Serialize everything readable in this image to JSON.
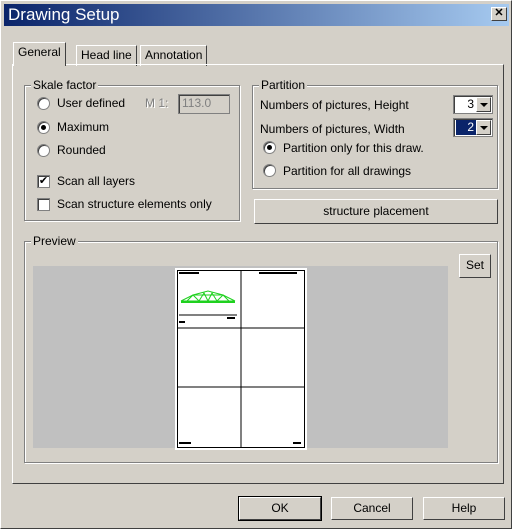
{
  "window": {
    "title": "Drawing Setup",
    "close_label": "✕"
  },
  "tabs": [
    {
      "label": "General"
    },
    {
      "label": "Head line"
    },
    {
      "label": "Annotation"
    }
  ],
  "skale": {
    "title": "Skale factor",
    "user_defined": "User defined",
    "m_label": "M 1:",
    "m_value": "113.0",
    "maximum": "Maximum",
    "rounded": "Rounded",
    "scan_all": "Scan all layers",
    "scan_structure": "Scan structure elements only"
  },
  "partition": {
    "title": "Partition",
    "height_label": "Numbers of pictures, Height",
    "height_value": "3",
    "width_label": "Numbers of pictures, Width",
    "width_value": "2",
    "only_this": "Partition only for this draw.",
    "all_drawings": "Partition for all drawings",
    "structure_btn": "structure placement"
  },
  "preview": {
    "title": "Preview",
    "set_btn": "Set"
  },
  "footer": {
    "ok": "OK",
    "cancel": "Cancel",
    "help": "Help"
  },
  "colors": {
    "title_start": "#0a246a",
    "title_end": "#a6caf0",
    "structure_green": "#1fd11f"
  }
}
